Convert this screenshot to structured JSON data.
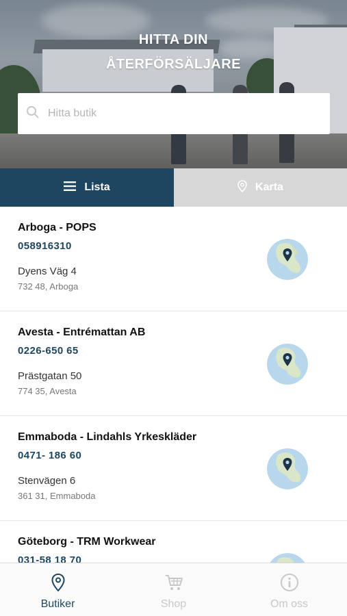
{
  "hero": {
    "title_line1": "HITTA DIN",
    "title_line2": "ÅTERFÖRSÄLJARE"
  },
  "search": {
    "placeholder": "Hitta butik",
    "value": ""
  },
  "view_toggle": {
    "list_label": "Lista",
    "map_label": "Karta",
    "selected": "Lista"
  },
  "stores": [
    {
      "name": "Arboga - POPS",
      "phone": "058916310",
      "street": "Dyens Väg 4",
      "city": "732 48, Arboga"
    },
    {
      "name": "Avesta - Entrémattan AB",
      "phone": "0226-650 65",
      "street": "Prästgatan 50",
      "city": "774 35, Avesta"
    },
    {
      "name": "Emmaboda - Lindahls Yrkeskläder",
      "phone": "0471- 186 60",
      "street": "Stenvägen 6",
      "city": "361 31, Emmaboda"
    },
    {
      "name": "Göteborg - TRM Workwear",
      "phone": "031-58 18 70",
      "street": "",
      "city": ""
    }
  ],
  "tabbar": {
    "items": [
      {
        "label": "Butiker",
        "icon": "location-pin-icon",
        "active": true
      },
      {
        "label": "Shop",
        "icon": "cart-icon",
        "active": false
      },
      {
        "label": "Om oss",
        "icon": "info-icon",
        "active": false
      }
    ]
  },
  "colors": {
    "accent": "#1f4660",
    "toggle_inactive": "#d7d7d7",
    "tab_inactive": "#c8c8c8"
  }
}
